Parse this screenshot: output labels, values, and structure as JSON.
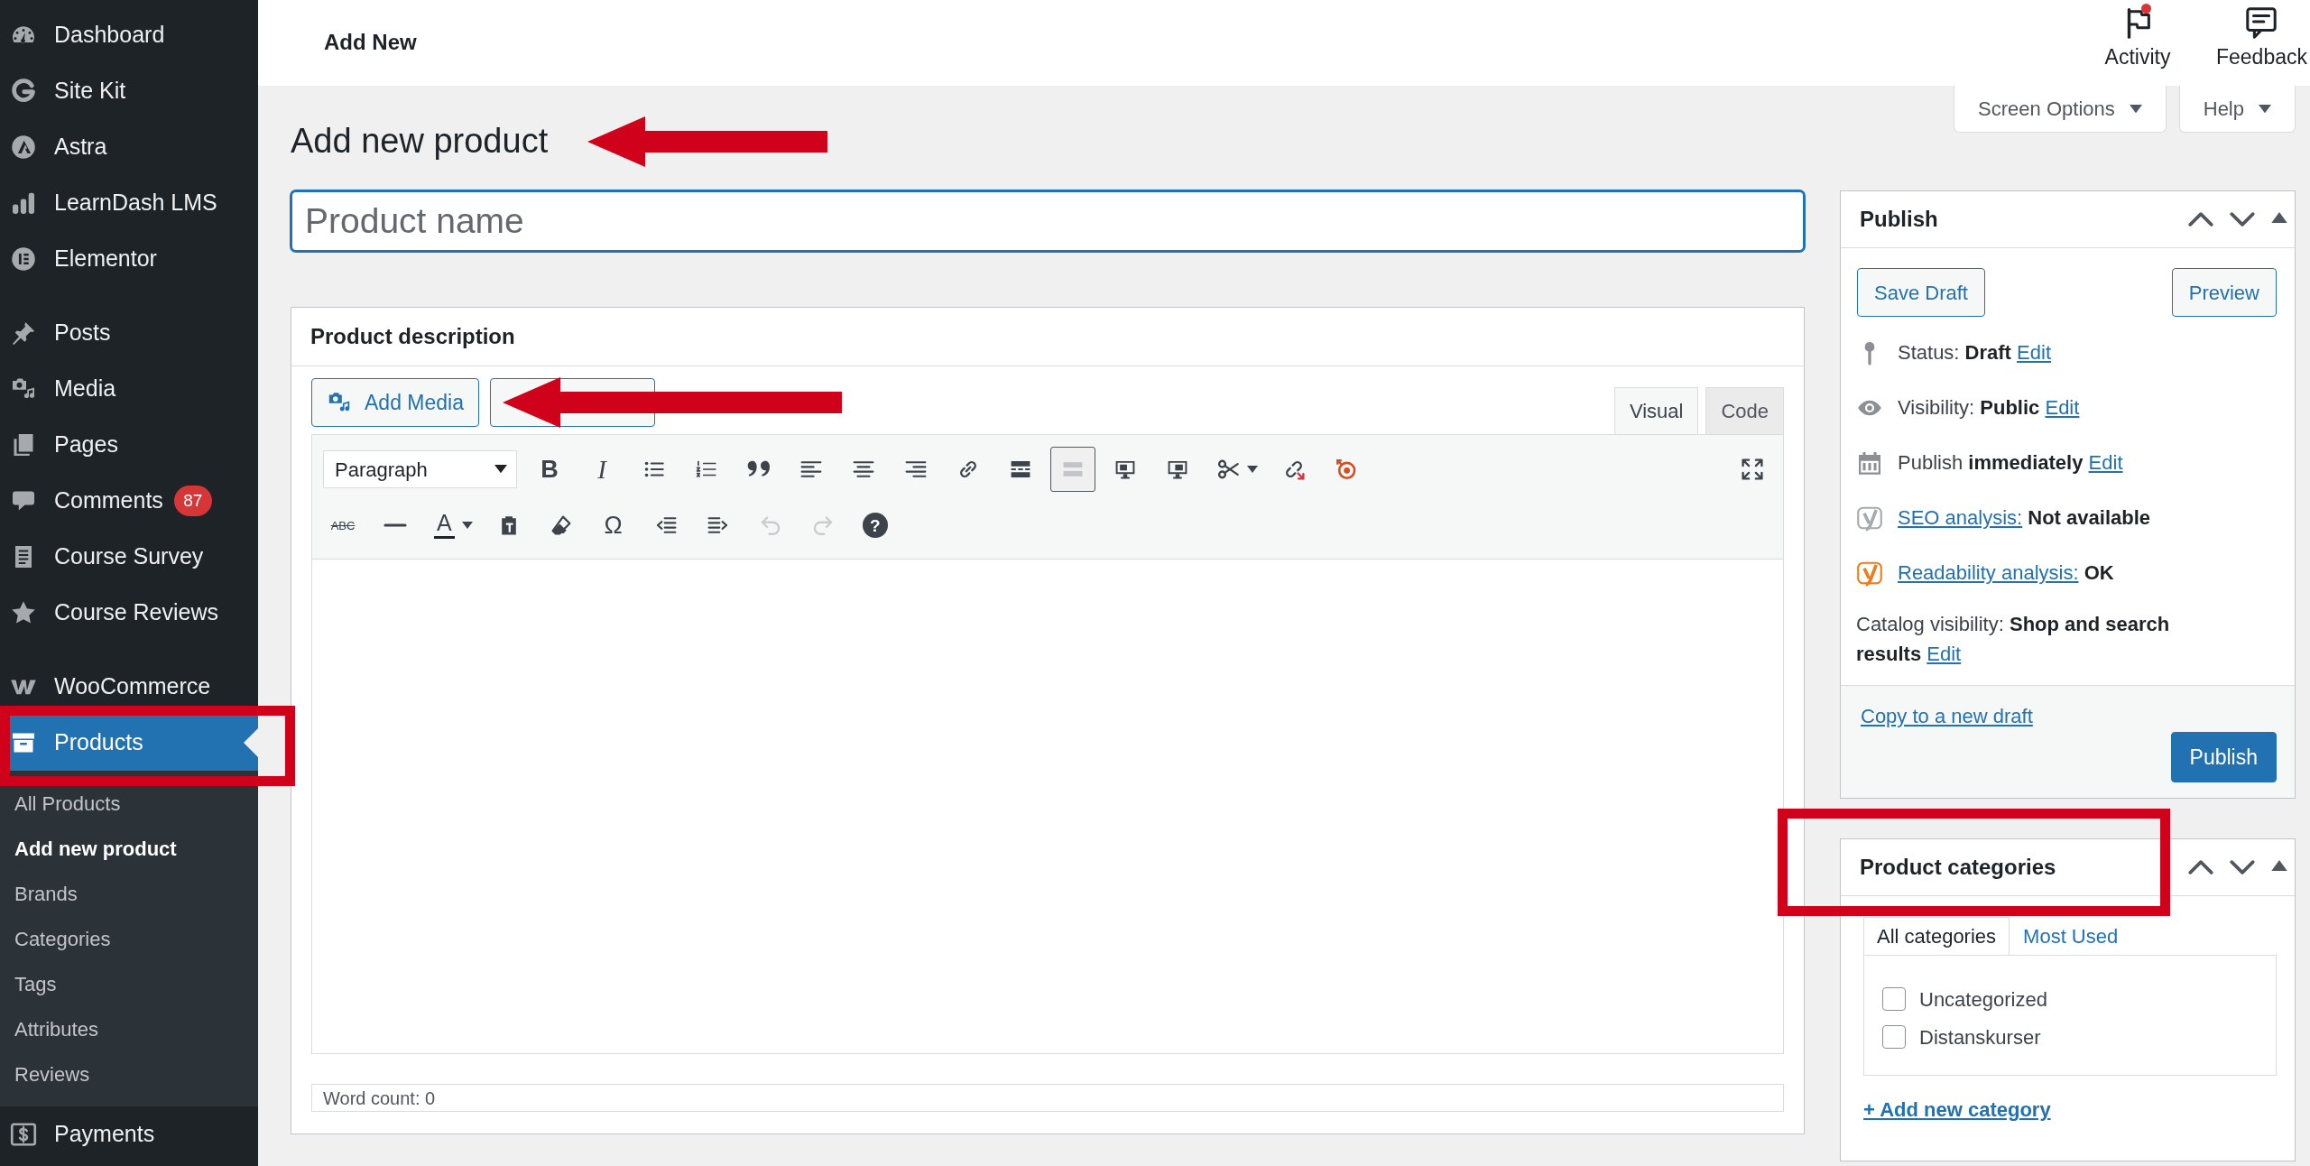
{
  "sidebar": {
    "groups": [
      {
        "items": [
          {
            "label": "Dashboard",
            "selected": false,
            "highlighted": false
          },
          {
            "label": "Site Kit",
            "selected": false,
            "highlighted": false
          },
          {
            "label": "Astra",
            "selected": false,
            "highlighted": false
          },
          {
            "label": "LearnDash LMS",
            "selected": false,
            "highlighted": false
          },
          {
            "label": "Elementor",
            "selected": false,
            "highlighted": false
          }
        ]
      },
      {
        "items": [
          {
            "label": "Posts",
            "selected": false,
            "highlighted": false
          },
          {
            "label": "Media",
            "selected": false,
            "highlighted": false
          },
          {
            "label": "Pages",
            "selected": false,
            "highlighted": false
          },
          {
            "label": "Comments",
            "selected": false,
            "highlighted": false,
            "badge": "87"
          },
          {
            "label": "Course Survey",
            "selected": false,
            "highlighted": false
          },
          {
            "label": "Course Reviews",
            "selected": false,
            "highlighted": false
          }
        ]
      },
      {
        "items": [
          {
            "label": "WooCommerce",
            "selected": false,
            "highlighted": false
          },
          {
            "label": "Products",
            "selected": true,
            "highlighted": true,
            "children": [
              {
                "label": "All Products",
                "selected": false
              },
              {
                "label": "Add new product",
                "selected": true
              },
              {
                "label": "Brands",
                "selected": false
              },
              {
                "label": "Categories",
                "selected": false
              },
              {
                "label": "Tags",
                "selected": false
              },
              {
                "label": "Attributes",
                "selected": false
              },
              {
                "label": "Reviews",
                "selected": false
              }
            ]
          },
          {
            "label": "Payments",
            "selected": false,
            "highlighted": false
          }
        ]
      }
    ]
  },
  "top_bar": {
    "title": "Add New",
    "actions": [
      {
        "label": "Activity",
        "notification": true
      },
      {
        "label": "Feedback",
        "notification": false
      }
    ]
  },
  "screen_meta": [
    {
      "label": "Screen Options"
    },
    {
      "label": "Help"
    }
  ],
  "page_title": {
    "text": "Add new product",
    "pointed_at": true
  },
  "product_name": {
    "placeholder": "Product name"
  },
  "description": {
    "title": "Product description",
    "media_buttons": [
      {
        "label": "Add Media",
        "pointed_at": false
      },
      {
        "pointed_at": true
      }
    ],
    "tabs": [
      {
        "label": "Visual",
        "selected": true
      },
      {
        "label": "Code",
        "selected": false
      }
    ],
    "toolbar": {
      "rows": [
        {
          "items": [
            {
              "kind": "dropdown",
              "value": "Paragraph"
            },
            {
              "kind": "button",
              "label": "B",
              "pressed": false,
              "disabled": false
            },
            {
              "kind": "button",
              "label": "I",
              "pressed": false,
              "disabled": false
            },
            {
              "kind": "button",
              "pressed": false,
              "disabled": false
            },
            {
              "kind": "button",
              "pressed": false,
              "disabled": false
            },
            {
              "kind": "button",
              "pressed": false,
              "disabled": false
            },
            {
              "kind": "button",
              "pressed": false,
              "disabled": false
            },
            {
              "kind": "button",
              "pressed": false,
              "disabled": false
            },
            {
              "kind": "button",
              "pressed": false,
              "disabled": false
            },
            {
              "kind": "button",
              "pressed": false,
              "disabled": false
            },
            {
              "kind": "button",
              "pressed": false,
              "disabled": false
            },
            {
              "kind": "button",
              "pressed": true,
              "disabled": false
            },
            {
              "kind": "button",
              "pressed": false,
              "disabled": false
            },
            {
              "kind": "button",
              "pressed": false,
              "disabled": false
            },
            {
              "kind": "split",
              "pressed": false,
              "disabled": false
            },
            {
              "kind": "button",
              "pressed": false,
              "disabled": false
            },
            {
              "kind": "button",
              "pressed": false,
              "disabled": false
            }
          ],
          "trailing": [
            {
              "kind": "button",
              "pressed": false,
              "disabled": false
            }
          ]
        },
        {
          "items": [
            {
              "kind": "button",
              "label": "ABC",
              "pressed": false,
              "disabled": false
            },
            {
              "kind": "button",
              "pressed": false,
              "disabled": false
            },
            {
              "kind": "split",
              "label": "A",
              "pressed": false,
              "disabled": false
            },
            {
              "kind": "button",
              "pressed": false,
              "disabled": false
            },
            {
              "kind": "button",
              "pressed": false,
              "disabled": false
            },
            {
              "kind": "button",
              "label": "Ω",
              "pressed": false,
              "disabled": false
            },
            {
              "kind": "button",
              "pressed": false,
              "disabled": false
            },
            {
              "kind": "button",
              "pressed": false,
              "disabled": false
            },
            {
              "kind": "button",
              "pressed": false,
              "disabled": true
            },
            {
              "kind": "button",
              "pressed": false,
              "disabled": true
            },
            {
              "kind": "button",
              "label": "?",
              "pressed": false,
              "disabled": false
            }
          ]
        }
      ]
    },
    "word_count": "Word count: 0"
  },
  "publish_box": {
    "title": "Publish",
    "highlighted": false,
    "buttons": [
      {
        "label": "Save Draft"
      },
      {
        "label": "Preview"
      }
    ],
    "meta": [
      {
        "parts": [
          {
            "kind": "text",
            "text": "Status:"
          },
          {
            "kind": "strong",
            "text": "Draft"
          },
          {
            "kind": "link",
            "text": "Edit"
          }
        ]
      },
      {
        "parts": [
          {
            "kind": "text",
            "text": "Visibility:"
          },
          {
            "kind": "strong",
            "text": "Public"
          },
          {
            "kind": "link",
            "text": "Edit"
          }
        ]
      },
      {
        "parts": [
          {
            "kind": "text",
            "text": "Publish"
          },
          {
            "kind": "strong",
            "text": "immediately"
          },
          {
            "kind": "link",
            "text": "Edit"
          }
        ]
      },
      {
        "color": "#a7aaad",
        "parts": [
          {
            "kind": "link",
            "text": "SEO analysis:"
          },
          {
            "kind": "strong",
            "text": "Not available"
          }
        ]
      },
      {
        "color": "#ee7c1b",
        "parts": [
          {
            "kind": "link",
            "text": "Readability analysis:"
          },
          {
            "kind": "strong",
            "text": "OK"
          }
        ]
      },
      {
        "parts": [
          {
            "kind": "text",
            "text": "Catalog visibility:"
          },
          {
            "kind": "strong",
            "text": "Shop and search results"
          },
          {
            "kind": "link",
            "text": "Edit"
          }
        ]
      }
    ],
    "copy_link": "Copy to a new draft",
    "publish_button": "Publish"
  },
  "categories_box": {
    "title": "Product categories",
    "highlighted": true,
    "tabs": [
      {
        "label": "All categories",
        "selected": true
      },
      {
        "label": "Most Used",
        "selected": false
      }
    ],
    "items": [
      {
        "label": "Uncategorized",
        "checked": false
      },
      {
        "label": "Distanskurser",
        "checked": false
      }
    ],
    "add_link": "+ Add new category"
  }
}
